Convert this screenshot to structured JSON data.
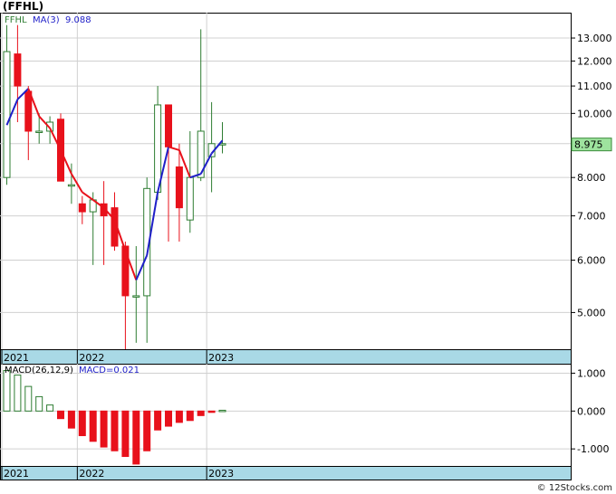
{
  "title": "(FFHL)",
  "credit": "© 12Stocks.com",
  "chart_data": [
    {
      "type": "candlestick",
      "ticker_label": "FFHL",
      "ma_label": "MA(3)",
      "ma_value": "9.088",
      "last_price_label": "8.975",
      "y_scale": "log",
      "ylim": [
        4.4,
        14.2
      ],
      "y_ticks": [
        {
          "value": 13,
          "label": "13.000"
        },
        {
          "value": 12,
          "label": "12.000"
        },
        {
          "value": 11,
          "label": "11.000"
        },
        {
          "value": 10,
          "label": "10.000"
        },
        {
          "value": 9,
          "label": "9.000"
        },
        {
          "value": 8,
          "label": "8.000"
        },
        {
          "value": 7,
          "label": "7.000"
        },
        {
          "value": 6,
          "label": "6.000"
        },
        {
          "value": 5,
          "label": "5.000"
        }
      ],
      "x_labels": [
        {
          "index": 0,
          "label": "2021"
        },
        {
          "index": 7,
          "label": "2022"
        },
        {
          "index": 19,
          "label": "2023"
        }
      ],
      "candles": [
        {
          "o": 8.0,
          "h": 13.6,
          "l": 7.8,
          "c": 12.4
        },
        {
          "o": 12.3,
          "h": 13.6,
          "l": 9.7,
          "c": 11.0
        },
        {
          "o": 10.8,
          "h": 11.0,
          "l": 8.5,
          "c": 9.4
        },
        {
          "o": 9.4,
          "h": 10.0,
          "l": 9.0,
          "c": 9.4
        },
        {
          "o": 9.4,
          "h": 9.9,
          "l": 9.0,
          "c": 9.7
        },
        {
          "o": 9.8,
          "h": 10.0,
          "l": 7.9,
          "c": 7.9
        },
        {
          "o": 7.8,
          "h": 8.4,
          "l": 7.3,
          "c": 7.8
        },
        {
          "o": 7.3,
          "h": 7.5,
          "l": 6.8,
          "c": 7.1
        },
        {
          "o": 7.1,
          "h": 7.6,
          "l": 5.9,
          "c": 7.4
        },
        {
          "o": 7.3,
          "h": 7.9,
          "l": 5.9,
          "c": 7.0
        },
        {
          "o": 7.2,
          "h": 7.6,
          "l": 6.2,
          "c": 6.3
        },
        {
          "o": 6.3,
          "h": 6.4,
          "l": 4.4,
          "c": 5.3
        },
        {
          "o": 5.3,
          "h": 6.3,
          "l": 4.5,
          "c": 5.3
        },
        {
          "o": 5.3,
          "h": 8.0,
          "l": 4.5,
          "c": 7.7
        },
        {
          "o": 7.6,
          "h": 11.0,
          "l": 7.4,
          "c": 10.3
        },
        {
          "o": 10.3,
          "h": 10.3,
          "l": 6.4,
          "c": 8.9
        },
        {
          "o": 8.3,
          "h": 9.0,
          "l": 6.4,
          "c": 7.2
        },
        {
          "o": 6.9,
          "h": 9.4,
          "l": 6.6,
          "c": 8.0
        },
        {
          "o": 8.0,
          "h": 13.4,
          "l": 7.9,
          "c": 9.4
        },
        {
          "o": 8.6,
          "h": 10.4,
          "l": 7.6,
          "c": 9.0
        },
        {
          "o": 9.0,
          "h": 9.7,
          "l": 8.7,
          "c": 9.0
        }
      ],
      "ma_series": [
        9.6,
        10.5,
        10.9,
        9.9,
        9.5,
        8.8,
        8.1,
        7.6,
        7.4,
        7.2,
        6.9,
        6.2,
        5.6,
        6.1,
        7.6,
        8.9,
        8.8,
        8.0,
        8.1,
        8.7,
        9.1
      ],
      "colors": {
        "up": "#2e7d32",
        "down": "#e8111b",
        "ma_up": "#1f1fc8",
        "ma_down": "#e8111b",
        "price_box": "#9ee39e"
      }
    },
    {
      "type": "bar",
      "label": "MACD(26,12,9)",
      "value_label": "MACD=0.021",
      "ylim": [
        -1.45,
        1.25
      ],
      "y_ticks": [
        {
          "value": 1.0,
          "label": "1.000"
        },
        {
          "value": 0.0,
          "label": "0.000"
        },
        {
          "value": -1.0,
          "label": "-1.000"
        }
      ],
      "x_labels": [
        {
          "index": 0,
          "label": "2021"
        },
        {
          "index": 7,
          "label": "2022"
        },
        {
          "index": 19,
          "label": "2023"
        }
      ],
      "values": [
        1.07,
        0.95,
        0.65,
        0.38,
        0.16,
        -0.2,
        -0.45,
        -0.65,
        -0.8,
        -0.95,
        -1.05,
        -1.2,
        -1.4,
        -1.05,
        -0.5,
        -0.4,
        -0.3,
        -0.25,
        -0.12,
        -0.03,
        0.021
      ],
      "colors": {
        "up": "#2e7d32",
        "down": "#e8111b"
      }
    }
  ]
}
